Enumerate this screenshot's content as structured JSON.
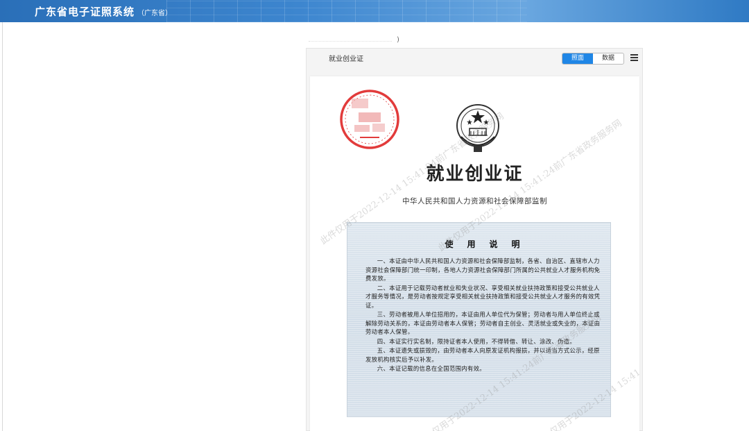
{
  "header": {
    "title": "广东省电子证照系统",
    "subtitle": "（广东省）"
  },
  "top_paren": ")",
  "viewer": {
    "title": "就业创业证",
    "view_toggle": [
      {
        "label": "照面",
        "active": true
      },
      {
        "label": "数据",
        "active": false
      }
    ],
    "menu_icon": "hamburger-menu-icon"
  },
  "certificate": {
    "title": "就业创业证",
    "subtitle": "中华人民共和国人力资源和社会保障部监制",
    "instructions_heading": "使用说明",
    "instructions": [
      "一、本证由中华人民共和国人力资源和社会保障部监制，各省、自治区、直辖市人力资源社会保障部门统一印制，各地人力资源社会保障部门所属的公共就业人才服务机构免费发放。",
      "二、本证用于记载劳动者就业和失业状况、享受相关就业扶持政策和接受公共就业人才服务等情况，是劳动者按规定享受相关就业扶持政策和接受公共就业人才服务的有效凭证。",
      "三、劳动者被用人单位招用的，本证由用人单位代为保管；劳动者与用人单位终止或解除劳动关系的，本证由劳动者本人保管；劳动者自主创业、灵活就业或失业的，本证由劳动者本人保管。",
      "四、本证实行实名制，限持证者本人使用，不得转借、转让、涂改、伪造。",
      "五、本证遗失或损毁的，由劳动者本人向原发证机构报损，并以适当方式公示，经原发放机构核实后予以补发。",
      "六、本证记载的信息在全国范围内有效。"
    ],
    "seal_icon": "red-official-seal-icon",
    "emblem_icon": "national-emblem-icon",
    "watermark": "此件仅用于2022-12-14 15:41:24前广东省政务服务网"
  },
  "colors": {
    "header_blue": "#2f7ac4",
    "toggle_active": "#1f86e6",
    "seal_red": "#e23b3b"
  }
}
